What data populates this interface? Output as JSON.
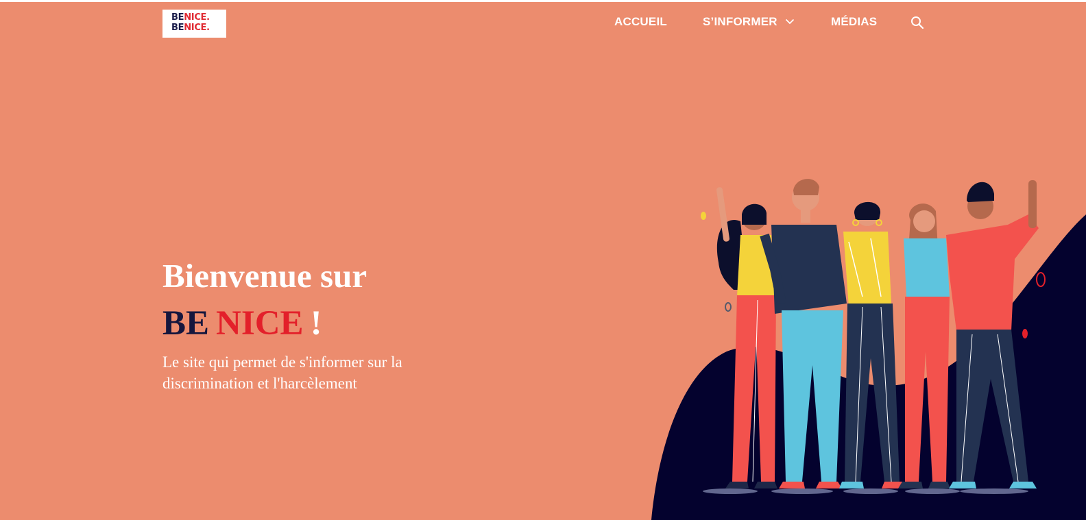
{
  "header": {
    "logo": {
      "line1": {
        "be": "BE",
        "nice": "NICE."
      },
      "line2": {
        "be": "BE",
        "nice": "NICE."
      }
    },
    "nav": [
      {
        "label": "ACCUEIL"
      },
      {
        "label": "S’INFORMER",
        "icon": "chevron-down-icon"
      },
      {
        "label": "MÉDIAS"
      }
    ],
    "search_icon": "search-icon"
  },
  "hero": {
    "title": "Bienvenue sur",
    "brand_be": "BE",
    "brand_nice": "NICE",
    "brand_exclaim": "!",
    "subtitle": "Le site qui permet de s'informer sur la discrimination et l'harcèlement"
  },
  "colors": {
    "background": "#ec8c6e",
    "brand_dark": "#15163d",
    "brand_red": "#e3202a",
    "text_light": "#ffffff",
    "wave": "#04022e"
  },
  "illustration": "group-of-friends-illustration"
}
